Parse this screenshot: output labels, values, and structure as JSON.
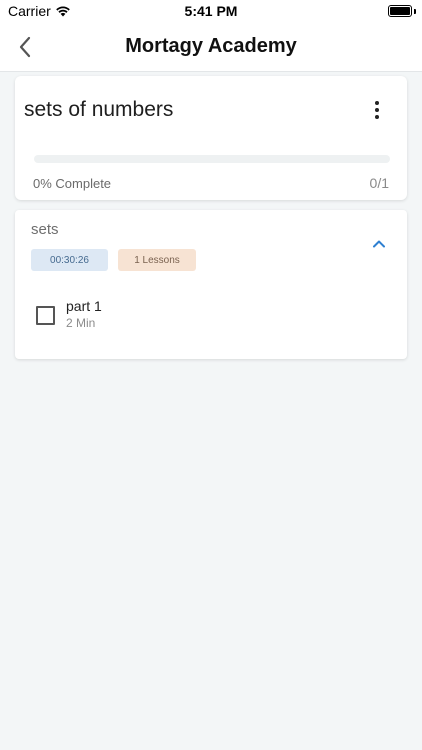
{
  "status_bar": {
    "carrier": "Carrier",
    "time": "5:41 PM",
    "wifi_icon": "wifi-icon",
    "battery_icon": "battery-icon"
  },
  "nav": {
    "title": "Mortagy Academy",
    "back_icon": "chevron-left-icon"
  },
  "course": {
    "title": "sets of numbers",
    "menu_icon": "more-vertical-icon",
    "progress_percent": 0,
    "progress_label": "0% Complete",
    "progress_count": "0/1"
  },
  "section": {
    "title": "sets",
    "duration": "00:30:26",
    "lessons_count": "1 Lessons",
    "toggle_icon": "chevron-up-icon",
    "lessons": [
      {
        "title": "part 1",
        "duration": "2 Min",
        "completed": false
      }
    ]
  },
  "colors": {
    "accent": "#2f80d1",
    "background": "#f3f6f7",
    "badge_duration_bg": "#dde8f4",
    "badge_lessons_bg": "#f7e3d3"
  }
}
